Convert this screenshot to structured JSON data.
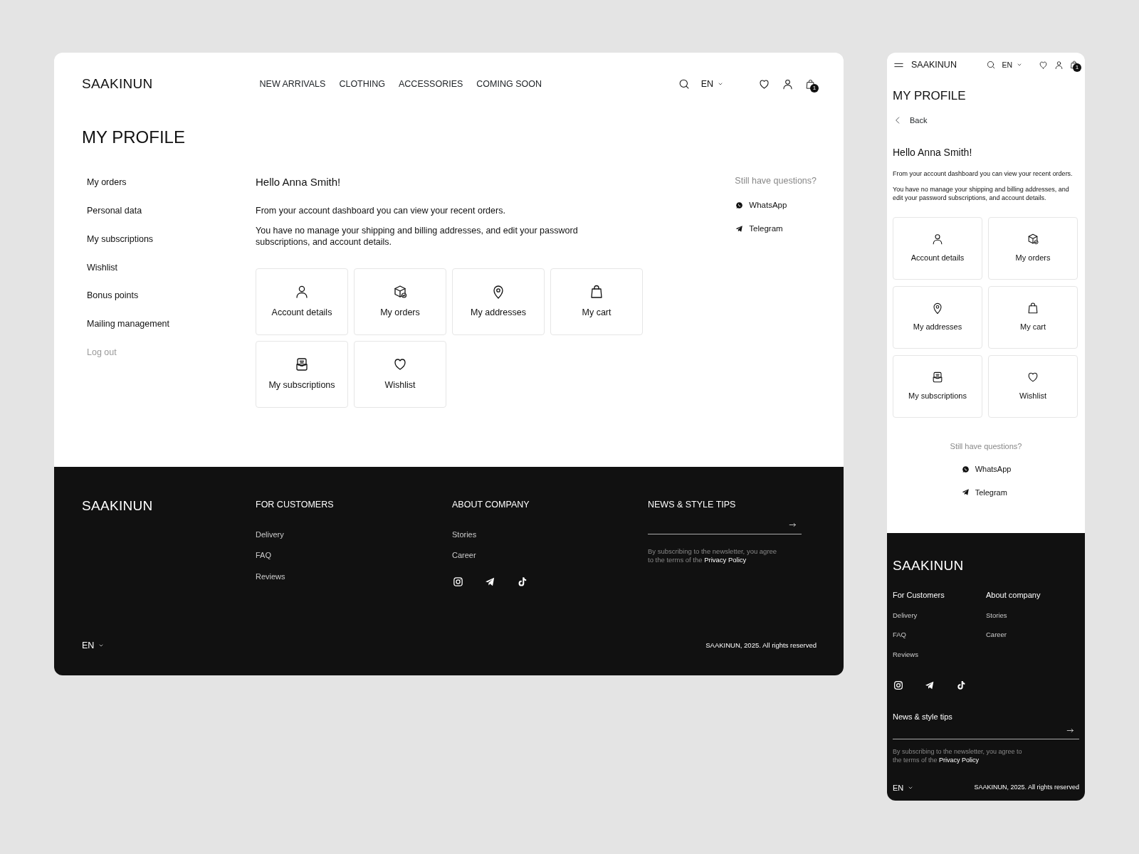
{
  "desktop": {
    "brand": "SAAKINUN",
    "nav": [
      "NEW ARRIVALS",
      "CLOTHING",
      "ACCESSORIES",
      "COMING SOON"
    ],
    "lang": "EN",
    "cart_count": "1",
    "title": "MY PROFILE",
    "sidebar": [
      {
        "label": "My orders",
        "kind": "link"
      },
      {
        "label": "Personal data",
        "kind": "link"
      },
      {
        "label": "My subscriptions",
        "kind": "link"
      },
      {
        "label": "Wishlist",
        "kind": "link"
      },
      {
        "label": "Bonus points",
        "kind": "link"
      },
      {
        "label": "Mailing management",
        "kind": "link"
      },
      {
        "label": "Log out",
        "kind": "logout"
      }
    ],
    "greeting": "Hello Anna Smith!",
    "paragraphs": [
      "From your account dashboard you can view your recent orders.",
      "You have no manage your shipping and billing addresses, and edit your password subscriptions, and account details."
    ],
    "tiles": [
      "Account details",
      "My orders",
      "My addresses",
      "My cart",
      "My subscriptions",
      "Wishlist"
    ],
    "questions": {
      "title": "Still have questions?",
      "links": [
        "WhatsApp",
        "Telegram"
      ]
    },
    "footer": {
      "brand": "SAAKINUN",
      "columns": [
        {
          "title": "FOR CUSTOMERS",
          "links": [
            "Delivery",
            "FAQ",
            "Reviews"
          ]
        },
        {
          "title": "ABOUT COMPANY",
          "links": [
            "Stories",
            "Career"
          ]
        }
      ],
      "newsletter": {
        "title": "NEWS & STYLE TIPS",
        "note": "By subscribing to the newsletter, you agree to the terms of the",
        "link": "Privacy Policy"
      },
      "lang": "EN",
      "copyright": "SAAKINUN, 2025. All rights reserved"
    }
  },
  "mobile": {
    "brand": "SAAKINUN",
    "lang": "EN",
    "cart_count": "1",
    "title": "MY PROFILE",
    "back": "Back",
    "greeting": "Hello Anna Smith!",
    "paragraphs": [
      "From your account dashboard you can view your recent orders.",
      "You have no manage your shipping and billing addresses, and edit your password subscriptions, and account details."
    ],
    "tiles": [
      "Account details",
      "My orders",
      "My addresses",
      "My cart",
      "My subscriptions",
      "Wishlist"
    ],
    "questions": {
      "title": "Still have questions?",
      "links": [
        "WhatsApp",
        "Telegram"
      ]
    },
    "footer": {
      "brand": "SAAKINUN",
      "columns": [
        {
          "title": "For Customers",
          "links": [
            "Delivery",
            "FAQ",
            "Reviews"
          ]
        },
        {
          "title": "About company",
          "links": [
            "Stories",
            "Career"
          ]
        }
      ],
      "newsletter": {
        "title": "News & style tips",
        "note": "By subscribing to the newsletter, you agree to the terms of the",
        "link": "Privacy Policy"
      },
      "lang": "EN",
      "copyright": "SAAKINUN, 2025. All rights reserved"
    }
  }
}
